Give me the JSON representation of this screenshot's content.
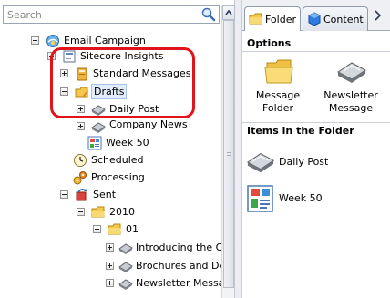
{
  "search": {
    "placeholder": "Search"
  },
  "tree": {
    "root": "Email Campaign",
    "sitecore_insights": "Sitecore Insights",
    "standard_messages": "Standard Messages",
    "drafts": "Drafts",
    "daily_post": "Daily Post",
    "company_news": "Company News",
    "week_50": "Week 50",
    "scheduled": "Scheduled",
    "processing": "Processing",
    "sent": "Sent",
    "year_2010": "2010",
    "month_01": "01",
    "introducing": "Introducing the OM",
    "brochures": "Brochures and Dem",
    "newsletter_message": "Newsletter Messag"
  },
  "tabs": {
    "folder": "Folder",
    "content": "Content"
  },
  "options": {
    "title": "Options",
    "message_folder": [
      "Message",
      "Folder"
    ],
    "newsletter_message": [
      "Newsletter",
      "Message"
    ]
  },
  "items_in_folder": {
    "title": "Items in the Folder",
    "items": [
      "Daily Post",
      "Week 50"
    ]
  },
  "colors": {
    "highlight": "#e0151b",
    "selection": "#e3ecfa",
    "folder": "#f3c84b"
  }
}
